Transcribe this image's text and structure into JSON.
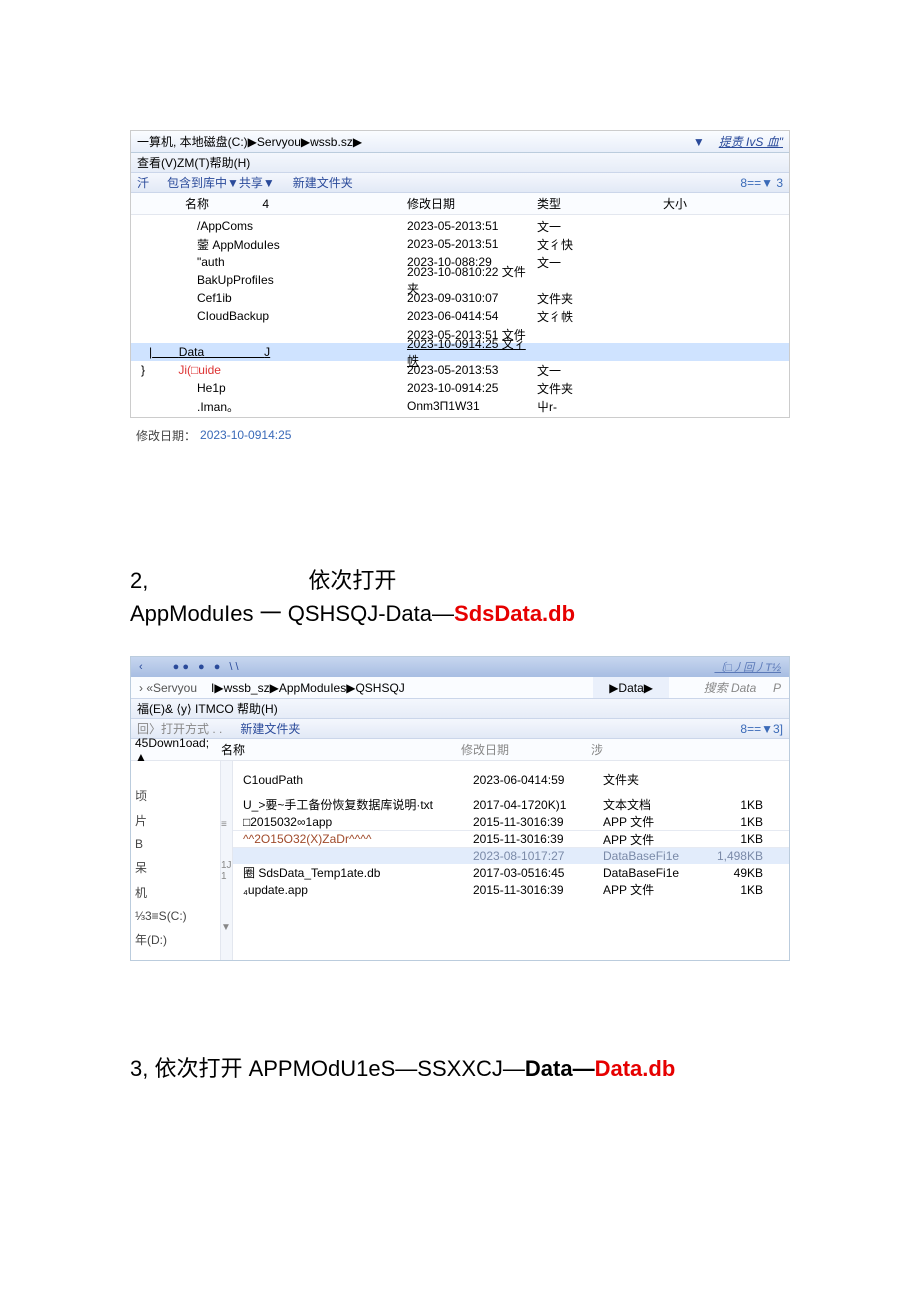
{
  "explorer1": {
    "addressbar": "一算机, 本地磁盘(C:)▶Servyou▶wssb.sz▶",
    "drop": "▼",
    "search": "提责 IvS 血\"",
    "menubar": "查看(V)ZM(T)帮助(H)",
    "toolbar": {
      "left": "汘",
      "include": "包含到库中▼共享▼",
      "newfolder": "新建文件夹",
      "right": "8==▼ 3"
    },
    "headers": {
      "name": "名称",
      "sort": "4",
      "date": "修改日期",
      "type": "类型",
      "size": "大小"
    },
    "rows": [
      {
        "name": "/AppComs",
        "date": "2023-05-2013:51",
        "type": "文一",
        "size": ""
      },
      {
        "name": "蓥 AppModuIes",
        "date": "2023-05-2013:51",
        "type": "文彳快",
        "size": ""
      },
      {
        "name": "\"auth",
        "date": "2023-10-088:29",
        "type": "文一",
        "size": ""
      },
      {
        "name": "    BakUpProfiIes",
        "date": "2023-10-0810:22 文件夹",
        "type": "",
        "size": ""
      },
      {
        "name": "  Cef1ib",
        "date": "2023-09-0310:07",
        "type": "文件夹",
        "size": ""
      },
      {
        "name": "  CIoudBackup",
        "date": "2023-06-0414:54",
        "type": "文彳帙",
        "size": ""
      },
      {
        "name": "",
        "date": "2023-05-2013:51 文件",
        "type": "",
        "size": ""
      }
    ],
    "selected": {
      "pre": "|",
      "name": "Data",
      "post": "J",
      "date": "2023-10-0914:25 文彳帙",
      "type": "",
      "size": ""
    },
    "after": [
      {
        "name": "Ji(□uide",
        "date": "2023-05-2013:53",
        "type": "文一",
        "size": "",
        "ji": true
      },
      {
        "name": "  He1p",
        "date": "2023-10-0914:25",
        "type": "文件夹",
        "size": ""
      },
      {
        "name": "  .Iman。",
        "date": "Onm3П1W31",
        "type": "屮r-",
        "size": ""
      }
    ],
    "brace": "}",
    "status_label": "修改日期：",
    "status_date": "2023-10-0914:25"
  },
  "step2": {
    "num": "2,",
    "open": "依次打开",
    "path_prefix": "AppModuIes 一 QSHSQJ-Data—",
    "path_red": "SdsData.db"
  },
  "explorer2": {
    "tabs_dots": "●●   ●    ●   \\\\",
    "tabs_right": "〔□⼃回⼃T½",
    "serv_left": "›     «Servyou",
    "path": "I▶wssb_sz▶AppModuIes▶QSHSQJ",
    "data_tab": "▶Data▶",
    "search_hint": "搜索 Data",
    "search_p": "P",
    "menubar": "福(E)& ⟨y⟩        ITMCO 帮助(H)",
    "toolbar": {
      "open": "回〉打开方式 . .",
      "newfolder": "新建文件夹",
      "right": "8==▼3]"
    },
    "left_header": "45Down1oad; ▲",
    "headers": {
      "name": "名称",
      "date": "修改日期",
      "type": "涉",
      "size": ""
    },
    "side": [
      "顷",
      "片",
      "B",
      "呆",
      "机",
      "⅓3≡S(C:)",
      "年(D:)"
    ],
    "side_mid": [
      "≡",
      "1J",
      "1",
      "▼"
    ],
    "rows": [
      {
        "name": "C1oudPath",
        "date": "2023-06-0414:59",
        "type": "文件夹",
        "size": ""
      },
      {
        "name": "U_>要~手工备份恢复数据库说明·txt",
        "date": "2017-04-1720K)1",
        "type": "文本文档",
        "size": "1KB"
      },
      {
        "name": "□2015032∞1app",
        "date": "2015-11-3016:39",
        "type": "APP 文件",
        "size": "1KB"
      },
      {
        "name": "^^2O15O32(X)ZaDr^^^^",
        "brown": true,
        "date": "2015-11-3016:39",
        "type": "APP 文件",
        "size": "1KB"
      }
    ],
    "selected": {
      "name": "",
      "date": "2023-08-1017:27",
      "type": "DataBaseFi1e",
      "size": "1,498KB"
    },
    "after": [
      {
        "name": "圈 SdsData_Temp1ate.db",
        "date": "2017-03-0516:45",
        "type": "DataBaseFi1e",
        "size": "49KB"
      },
      {
        "name": "₄update.app",
        "date": "2015-11-3016:39",
        "type": "APP 文件",
        "size": "1KB"
      }
    ]
  },
  "step3": {
    "prefix": "3, 依次打开 APPMOdU1eS—SSXXCJ—",
    "bold": "Data—",
    "red": "Data.db"
  }
}
